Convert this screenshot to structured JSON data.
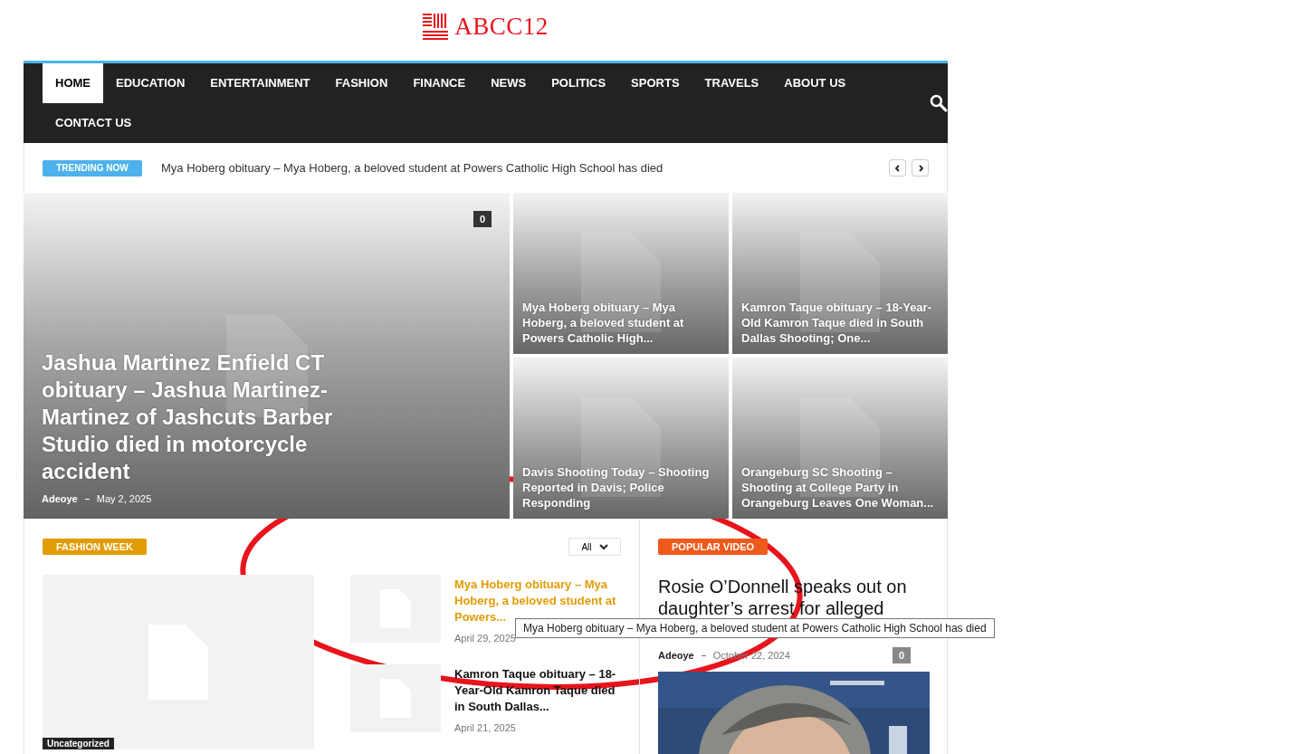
{
  "logo": {
    "text": "ABCC12"
  },
  "nav": {
    "items": [
      {
        "label": "HOME",
        "selected": true
      },
      {
        "label": "EDUCATION",
        "selected": false
      },
      {
        "label": "ENTERTAINMENT",
        "selected": false
      },
      {
        "label": "FASHION",
        "selected": false
      },
      {
        "label": "FINANCE",
        "selected": false
      },
      {
        "label": "NEWS",
        "selected": false
      },
      {
        "label": "POLITICS",
        "selected": false
      },
      {
        "label": "SPORTS",
        "selected": false
      },
      {
        "label": "TRAVELS",
        "selected": false
      },
      {
        "label": "ABOUT US",
        "selected": false
      },
      {
        "label": "CONTACT US",
        "selected": false
      }
    ]
  },
  "trending": {
    "label": "TRENDING NOW",
    "headline": "Mya Hoberg obituary – Mya Hoberg, a beloved student at Powers Catholic High School has died"
  },
  "featured": [
    {
      "title": "Jashua Martinez Enfield CT obituary – Jashua Martinez-Martinez of Jashcuts Barber Studio died in motorcycle accident",
      "author": "Adeoye",
      "date": "May 2, 2025",
      "comments": "0"
    },
    {
      "title": "Mya Hoberg obituary – Mya Hoberg, a beloved student at Powers Catholic High..."
    },
    {
      "title": "Kamron Taque obituary – 18-Year-Old Kamron Taque died in South Dallas Shooting; One..."
    },
    {
      "title": "Davis Shooting Today – Shooting Reported in Davis; Police Responding"
    },
    {
      "title": "Orangeburg SC Shooting – Shooting at College Party in Orangeburg Leaves One Woman..."
    }
  ],
  "fashion_week": {
    "label": "FASHION WEEK",
    "filter": "All",
    "main_tag": "Uncategorized",
    "posts": [
      {
        "title": "Mya Hoberg obituary – Mya Hoberg, a beloved student at Powers...",
        "date": "April 29, 2025",
        "hovered": true
      },
      {
        "title": "Kamron Taque obituary – 18-Year-Old Kamron Taque died in South Dallas...",
        "date": "April 21, 2025",
        "hovered": false
      }
    ]
  },
  "popular_video": {
    "label": "POPULAR VIDEO",
    "title": "Rosie O’Donnell speaks out on daughter’s arrest for alleged",
    "author": "Adeoye",
    "date": "October 22, 2024",
    "comments": "0"
  },
  "tooltip": {
    "text": "Mya Hoberg obituary – Mya Hoberg, a beloved student at Powers Catholic High School has died"
  }
}
